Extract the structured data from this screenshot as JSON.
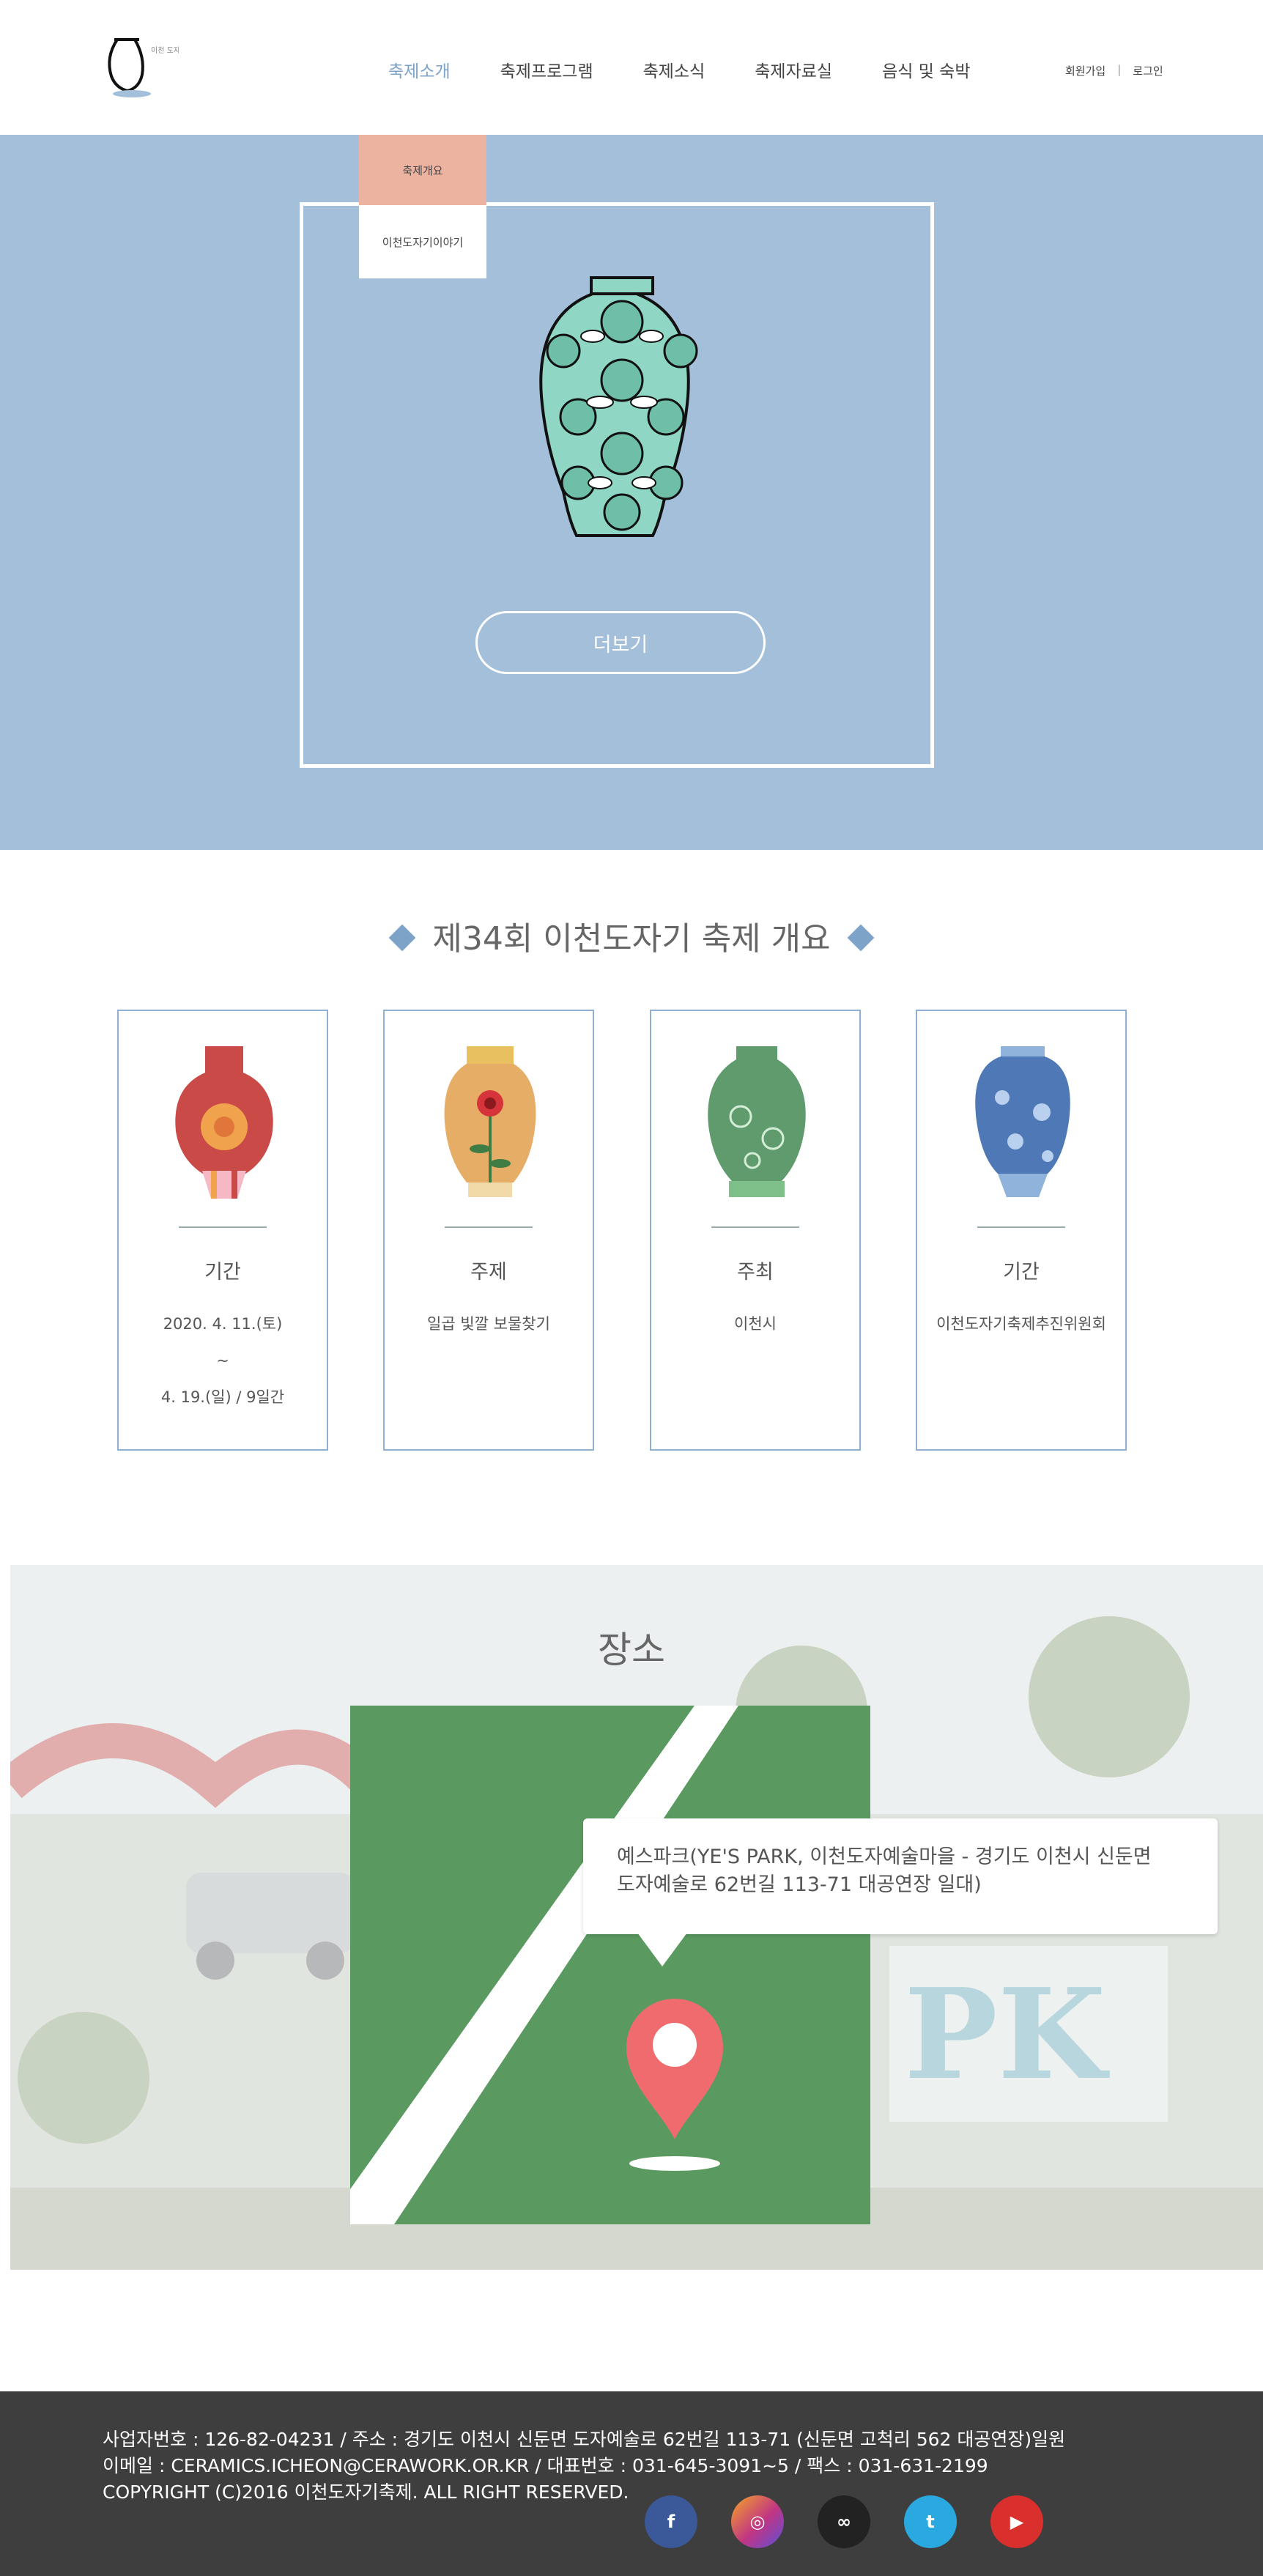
{
  "header": {
    "logo_text": "이천 도자기 축제",
    "nav": [
      "축제소개",
      "축제프로그램",
      "축제소식",
      "축제자료실",
      "음식 및 숙박"
    ],
    "signup": "회원가입",
    "separator": "|",
    "login": "로그인",
    "accent_color": "#7ea3c9"
  },
  "dropdown": {
    "items": [
      "축제개요",
      "이천도자기이야기"
    ]
  },
  "hero": {
    "more_button": "더보기",
    "background": "#a3bfd9"
  },
  "overview": {
    "title": "제34회 이천도자기 축제 개요",
    "cards": [
      {
        "title": "기간",
        "lines": [
          "2020. 4. 11.(토)",
          "~",
          "4. 19.(일) / 9일간"
        ],
        "icon": "red-vase-icon"
      },
      {
        "title": "주제",
        "lines": [
          "일곱 빛깔 보물찾기"
        ],
        "icon": "flower-vase-icon"
      },
      {
        "title": "주최",
        "lines": [
          "이천시"
        ],
        "icon": "green-vase-icon"
      },
      {
        "title": "기간",
        "lines": [
          "이천도자기축제추진위원회"
        ],
        "icon": "blue-vase-icon"
      }
    ]
  },
  "venue": {
    "title": "장소",
    "address_line1": "예스파크(YE'S PARK, 이천도자예술마을 - 경기도 이천시 신둔면",
    "address_line2": "도자예술로 62번길 113-71 대공연장 일대)",
    "map_color": "#5a9a60",
    "pin_color": "#f06b6e"
  },
  "footer": {
    "line1": "사업자번호 : 126-82-04231 / 주소 : 경기도 이천시 신둔면 도자예술로 62번길 113-71 (신둔면 고척리 562 대공연장)일원",
    "line2": "이메일 : CERAMICS.ICHEON@CERAWORK.OR.KR / 대표번호 : 031-645-3091~5 / 팩스 : 031-631-2199",
    "line3": "COPYRIGHT (C)2016 이천도자기축제. ALL RIGHT RESERVED.",
    "socials": [
      {
        "name": "facebook-icon",
        "glyph": "f",
        "color": "#3b5998"
      },
      {
        "name": "instagram-icon",
        "glyph": "◎",
        "color": "#c13584"
      },
      {
        "name": "link-icon",
        "glyph": "∞",
        "color": "#222222"
      },
      {
        "name": "twitter-icon",
        "glyph": "t",
        "color": "#29a9e0"
      },
      {
        "name": "youtube-icon",
        "glyph": "▶",
        "color": "#d9302e"
      }
    ]
  }
}
